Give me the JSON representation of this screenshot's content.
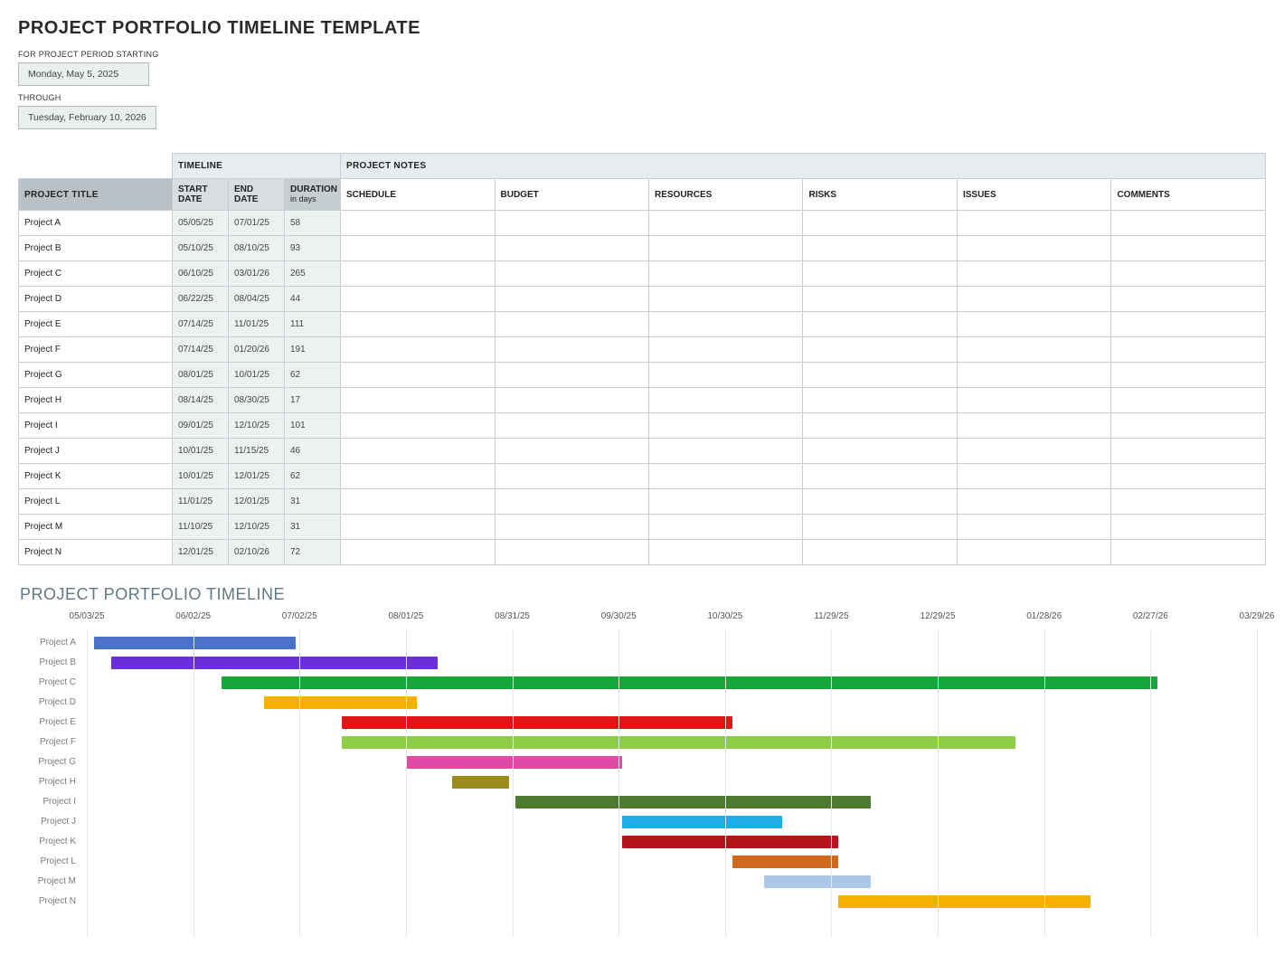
{
  "title": "PROJECT PORTFOLIO TIMELINE TEMPLATE",
  "period": {
    "start_label": "FOR PROJECT PERIOD STARTING",
    "start_value": "Monday, May 5, 2025",
    "through_label": "THROUGH",
    "end_value": "Tuesday, February 10, 2026"
  },
  "table": {
    "group_headers": {
      "timeline": "TIMELINE",
      "notes": "PROJECT NOTES"
    },
    "headers": {
      "project_title": "PROJECT TITLE",
      "start_date": "START DATE",
      "end_date": "END DATE",
      "duration": "DURATION",
      "duration_sub": "in days",
      "schedule": "SCHEDULE",
      "budget": "BUDGET",
      "resources": "RESOURCES",
      "risks": "RISKS",
      "issues": "ISSUES",
      "comments": "COMMENTS"
    },
    "rows": [
      {
        "title": "Project A",
        "start": "05/05/25",
        "end": "07/01/25",
        "duration": "58"
      },
      {
        "title": "Project B",
        "start": "05/10/25",
        "end": "08/10/25",
        "duration": "93"
      },
      {
        "title": "Project C",
        "start": "06/10/25",
        "end": "03/01/26",
        "duration": "265"
      },
      {
        "title": "Project D",
        "start": "06/22/25",
        "end": "08/04/25",
        "duration": "44"
      },
      {
        "title": "Project E",
        "start": "07/14/25",
        "end": "11/01/25",
        "duration": "111"
      },
      {
        "title": "Project F",
        "start": "07/14/25",
        "end": "01/20/26",
        "duration": "191"
      },
      {
        "title": "Project G",
        "start": "08/01/25",
        "end": "10/01/25",
        "duration": "62"
      },
      {
        "title": "Project H",
        "start": "08/14/25",
        "end": "08/30/25",
        "duration": "17"
      },
      {
        "title": "Project I",
        "start": "09/01/25",
        "end": "12/10/25",
        "duration": "101"
      },
      {
        "title": "Project J",
        "start": "10/01/25",
        "end": "11/15/25",
        "duration": "46"
      },
      {
        "title": "Project K",
        "start": "10/01/25",
        "end": "12/01/25",
        "duration": "62"
      },
      {
        "title": "Project L",
        "start": "11/01/25",
        "end": "12/01/25",
        "duration": "31"
      },
      {
        "title": "Project M",
        "start": "11/10/25",
        "end": "12/10/25",
        "duration": "31"
      },
      {
        "title": "Project N",
        "start": "12/01/25",
        "end": "02/10/26",
        "duration": "72"
      }
    ]
  },
  "gantt": {
    "title": "PROJECT PORTFOLIO TIMELINE",
    "ticks": [
      "05/03/25",
      "06/02/25",
      "07/02/25",
      "08/01/25",
      "08/31/25",
      "09/30/25",
      "10/30/25",
      "11/29/25",
      "12/29/25",
      "01/28/26",
      "02/27/26",
      "03/29/26"
    ]
  },
  "chart_data": {
    "type": "bar",
    "orientation": "horizontal-gantt",
    "title": "PROJECT PORTFOLIO TIMELINE",
    "x_axis": {
      "type": "date",
      "min": "2025-05-03",
      "max": "2026-03-29",
      "ticks": [
        "2025-05-03",
        "2025-06-02",
        "2025-07-02",
        "2025-08-01",
        "2025-08-31",
        "2025-09-30",
        "2025-10-30",
        "2025-11-29",
        "2025-12-29",
        "2026-01-28",
        "2026-02-27",
        "2026-03-29"
      ]
    },
    "series": [
      {
        "name": "Project A",
        "start": "2025-05-05",
        "end": "2025-07-01",
        "duration_days": 58,
        "color": "#4a72c8"
      },
      {
        "name": "Project B",
        "start": "2025-05-10",
        "end": "2025-08-10",
        "duration_days": 93,
        "color": "#6a2fd8"
      },
      {
        "name": "Project C",
        "start": "2025-06-10",
        "end": "2026-03-01",
        "duration_days": 265,
        "color": "#17a63b"
      },
      {
        "name": "Project D",
        "start": "2025-06-22",
        "end": "2025-08-04",
        "duration_days": 44,
        "color": "#f6b000"
      },
      {
        "name": "Project E",
        "start": "2025-07-14",
        "end": "2025-11-01",
        "duration_days": 111,
        "color": "#e01515"
      },
      {
        "name": "Project F",
        "start": "2025-07-14",
        "end": "2026-01-20",
        "duration_days": 191,
        "color": "#8fce44"
      },
      {
        "name": "Project G",
        "start": "2025-08-01",
        "end": "2025-10-01",
        "duration_days": 62,
        "color": "#e04aa6"
      },
      {
        "name": "Project H",
        "start": "2025-08-14",
        "end": "2025-08-30",
        "duration_days": 17,
        "color": "#9b8b1c"
      },
      {
        "name": "Project I",
        "start": "2025-09-01",
        "end": "2025-12-10",
        "duration_days": 101,
        "color": "#4c7a2f"
      },
      {
        "name": "Project J",
        "start": "2025-10-01",
        "end": "2025-11-15",
        "duration_days": 46,
        "color": "#1daee8"
      },
      {
        "name": "Project K",
        "start": "2025-10-01",
        "end": "2025-12-01",
        "duration_days": 62,
        "color": "#b5141a"
      },
      {
        "name": "Project L",
        "start": "2025-11-01",
        "end": "2025-12-01",
        "duration_days": 31,
        "color": "#d0691b"
      },
      {
        "name": "Project M",
        "start": "2025-11-10",
        "end": "2025-12-10",
        "duration_days": 31,
        "color": "#aac7ea"
      },
      {
        "name": "Project N",
        "start": "2025-12-01",
        "end": "2026-02-10",
        "duration_days": 72,
        "color": "#f6b000"
      }
    ]
  }
}
